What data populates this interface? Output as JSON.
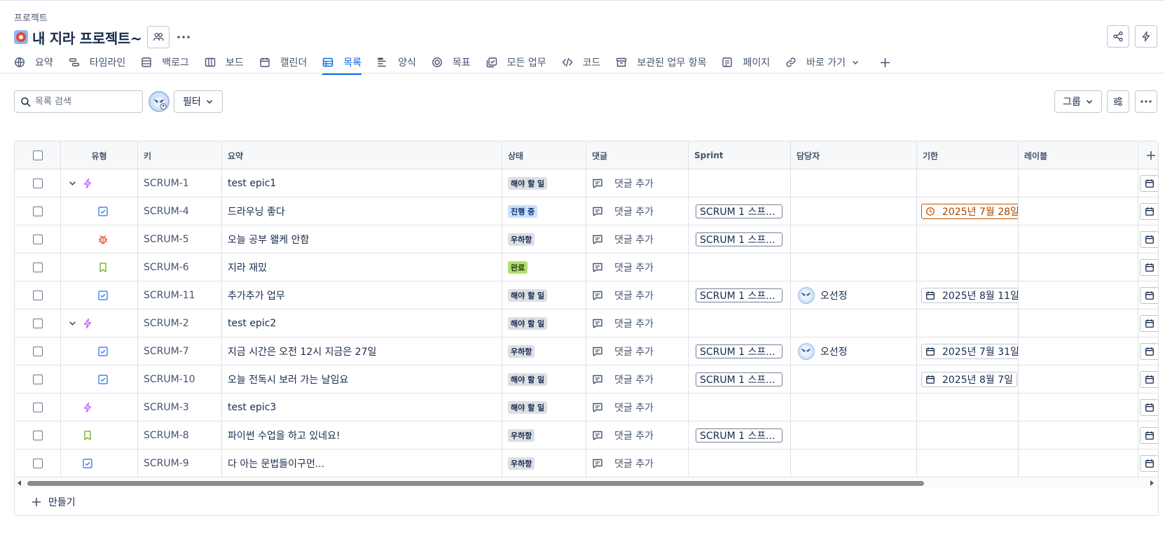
{
  "breadcrumb": "프로젝트",
  "project": {
    "title": "내 지라 프로젝트~"
  },
  "tabs": [
    {
      "label": "요약",
      "icon": "globe-icon"
    },
    {
      "label": "타임라인",
      "icon": "timeline-icon"
    },
    {
      "label": "백로그",
      "icon": "backlog-icon"
    },
    {
      "label": "보드",
      "icon": "board-icon"
    },
    {
      "label": "캘린더",
      "icon": "calendar-icon"
    },
    {
      "label": "목록",
      "icon": "list-icon",
      "active": true
    },
    {
      "label": "양식",
      "icon": "form-icon"
    },
    {
      "label": "목표",
      "icon": "goal-icon"
    },
    {
      "label": "모든 업무",
      "icon": "all-work-icon"
    },
    {
      "label": "코드",
      "icon": "code-icon"
    },
    {
      "label": "보관된 업무 항목",
      "icon": "archive-icon"
    },
    {
      "label": "페이지",
      "icon": "page-icon"
    },
    {
      "label": "바로 가기",
      "icon": "link-icon"
    }
  ],
  "toolbar": {
    "search_placeholder": "목록 검색",
    "filter_label": "필터",
    "group_label": "그룹"
  },
  "columns": {
    "type": "유형",
    "key": "키",
    "summary": "요약",
    "status": "상태",
    "comments": "댓글",
    "sprint": "Sprint",
    "assignee": "담당자",
    "due": "기한",
    "labels": "레이블"
  },
  "rows": [
    {
      "key": "SCRUM-1",
      "summary": "test epic1",
      "type": "epic",
      "expand": true,
      "indent": 0,
      "status": "해야 할 일",
      "status_kind": "todo",
      "comment": "댓글 추가",
      "sprint": "",
      "assignee": "",
      "due": "",
      "due_kind": ""
    },
    {
      "key": "SCRUM-4",
      "summary": "드라우닝 좋다",
      "type": "task",
      "expand": false,
      "indent": 1,
      "status": "진행 중",
      "status_kind": "inprogress",
      "comment": "댓글 추가",
      "sprint": "SCRUM 1 스프...",
      "assignee": "",
      "due": "2025년 7월 28일",
      "due_kind": "overdue"
    },
    {
      "key": "SCRUM-5",
      "summary": "오늘 공부 왤케 안함",
      "type": "bug",
      "expand": false,
      "indent": 1,
      "status": "우하항",
      "status_kind": "todo",
      "comment": "댓글 추가",
      "sprint": "SCRUM 1 스프...",
      "assignee": "",
      "due": "",
      "due_kind": ""
    },
    {
      "key": "SCRUM-6",
      "summary": "지라 재밌",
      "type": "story",
      "expand": false,
      "indent": 1,
      "status": "완료",
      "status_kind": "done",
      "comment": "댓글 추가",
      "sprint": "",
      "assignee": "",
      "due": "",
      "due_kind": ""
    },
    {
      "key": "SCRUM-11",
      "summary": "추가추가 업무",
      "type": "task",
      "expand": false,
      "indent": 1,
      "status": "해야 할 일",
      "status_kind": "todo",
      "comment": "댓글 추가",
      "sprint": "SCRUM 1 스프...",
      "assignee": "오선정",
      "due": "2025년 8월 11일",
      "due_kind": "normal"
    },
    {
      "key": "SCRUM-2",
      "summary": "test epic2",
      "type": "epic",
      "expand": true,
      "indent": 0,
      "status": "해야 할 일",
      "status_kind": "todo",
      "comment": "댓글 추가",
      "sprint": "",
      "assignee": "",
      "due": "",
      "due_kind": ""
    },
    {
      "key": "SCRUM-7",
      "summary": "지금 시간은 오전 12시 지금은 27일",
      "type": "task",
      "expand": false,
      "indent": 1,
      "status": "우하항",
      "status_kind": "todo",
      "comment": "댓글 추가",
      "sprint": "SCRUM 1 스프...",
      "assignee": "오선정",
      "due": "2025년 7월 31일",
      "due_kind": "normal"
    },
    {
      "key": "SCRUM-10",
      "summary": "오늘 전독시 보러 가는 날임요",
      "type": "task",
      "expand": false,
      "indent": 1,
      "status": "해야 할 일",
      "status_kind": "todo",
      "comment": "댓글 추가",
      "sprint": "SCRUM 1 스프...",
      "assignee": "",
      "due": "2025년 8월 7일",
      "due_kind": "normal"
    },
    {
      "key": "SCRUM-3",
      "summary": "test epic3",
      "type": "epic",
      "expand": false,
      "indent": 0,
      "status": "해야 할 일",
      "status_kind": "todo",
      "comment": "댓글 추가",
      "sprint": "",
      "assignee": "",
      "due": "",
      "due_kind": ""
    },
    {
      "key": "SCRUM-8",
      "summary": "파이썬 수업을 하고 있네요!",
      "type": "story",
      "expand": false,
      "indent": 0,
      "status": "우하항",
      "status_kind": "todo",
      "comment": "댓글 추가",
      "sprint": "SCRUM 1 스프...",
      "assignee": "",
      "due": "",
      "due_kind": ""
    },
    {
      "key": "SCRUM-9",
      "summary": "다 아는 문법들이구먼...",
      "type": "task",
      "expand": false,
      "indent": 0,
      "status": "우하항",
      "status_kind": "todo",
      "comment": "댓글 추가",
      "sprint": "",
      "assignee": "",
      "due": "",
      "due_kind": ""
    }
  ],
  "create_label": "만들기",
  "colors": {
    "accent": "#0c66e4",
    "epic": "#bf63f3",
    "task": "#4688ec",
    "bug": "#e2483d",
    "story": "#82b536",
    "overdue": "#c25100"
  }
}
